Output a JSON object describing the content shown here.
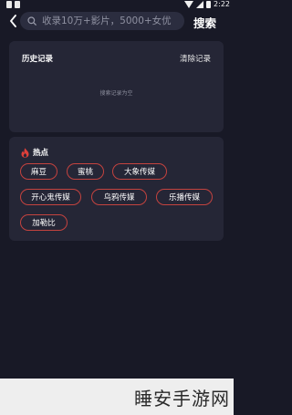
{
  "status_bar": {
    "time": "2:22"
  },
  "header": {
    "search_placeholder": "收录10万+影片，5000+女优",
    "search_button": "搜索"
  },
  "history": {
    "title": "历史记录",
    "clear_label": "清除记录",
    "empty_text": "搜索记录为空"
  },
  "hot": {
    "title": "热点",
    "accent_color": "#e0403a",
    "tags": [
      "麻豆",
      "蜜桃",
      "大象传媒",
      "开心鬼传媒",
      "乌鸦传媒",
      "乐播传媒",
      "加勒比"
    ]
  },
  "watermark": {
    "text": "睡安手游网"
  }
}
